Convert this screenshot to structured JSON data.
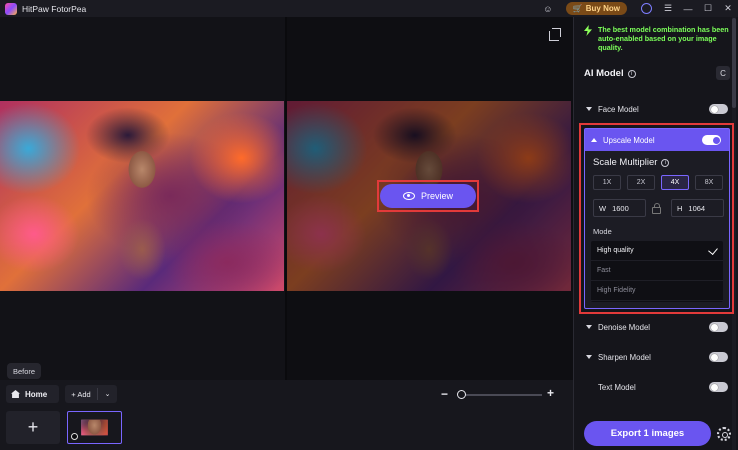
{
  "titlebar": {
    "app_title": "HitPaw FotorPea",
    "buy_now": "Buy Now",
    "icons": [
      "discord-icon",
      "cart-icon",
      "account-icon",
      "menu-icon",
      "minimize-icon",
      "maximize-icon",
      "close-icon"
    ]
  },
  "canvas": {
    "preview_label": "Preview",
    "before_label": "Before"
  },
  "bottom": {
    "home_label": "Home",
    "add_label": "+ Add",
    "zoom_minus": "−",
    "zoom_plus": "+",
    "zoom_level": 0,
    "new_tile": "+"
  },
  "panel": {
    "notice": "The best model combination has been auto-enabled based on your image quality.",
    "ai_model_title": "AI Model",
    "reset_label": "C",
    "models": [
      {
        "name": "Face Model",
        "enabled": false
      },
      {
        "name": "Upscale Model",
        "enabled": true
      },
      {
        "name": "Denoise Model",
        "enabled": false
      },
      {
        "name": "Sharpen Model",
        "enabled": false
      },
      {
        "name": "Text Model",
        "enabled": false
      }
    ],
    "upscale": {
      "scale_title": "Scale Multiplier",
      "multipliers": [
        "1X",
        "2X",
        "4X",
        "8X"
      ],
      "selected_multiplier": "4X",
      "width_label": "W",
      "width_value": "1600",
      "height_label": "H",
      "height_value": "1064",
      "mode_label": "Mode",
      "modes": [
        "High quality",
        "Fast",
        "High Fidelity"
      ],
      "selected_mode": "High quality"
    },
    "export_label": "Export 1 images"
  },
  "colors": {
    "accent": "#6a55f0",
    "highlight_outline": "#e23a3a",
    "notice_green": "#7cff5a"
  }
}
